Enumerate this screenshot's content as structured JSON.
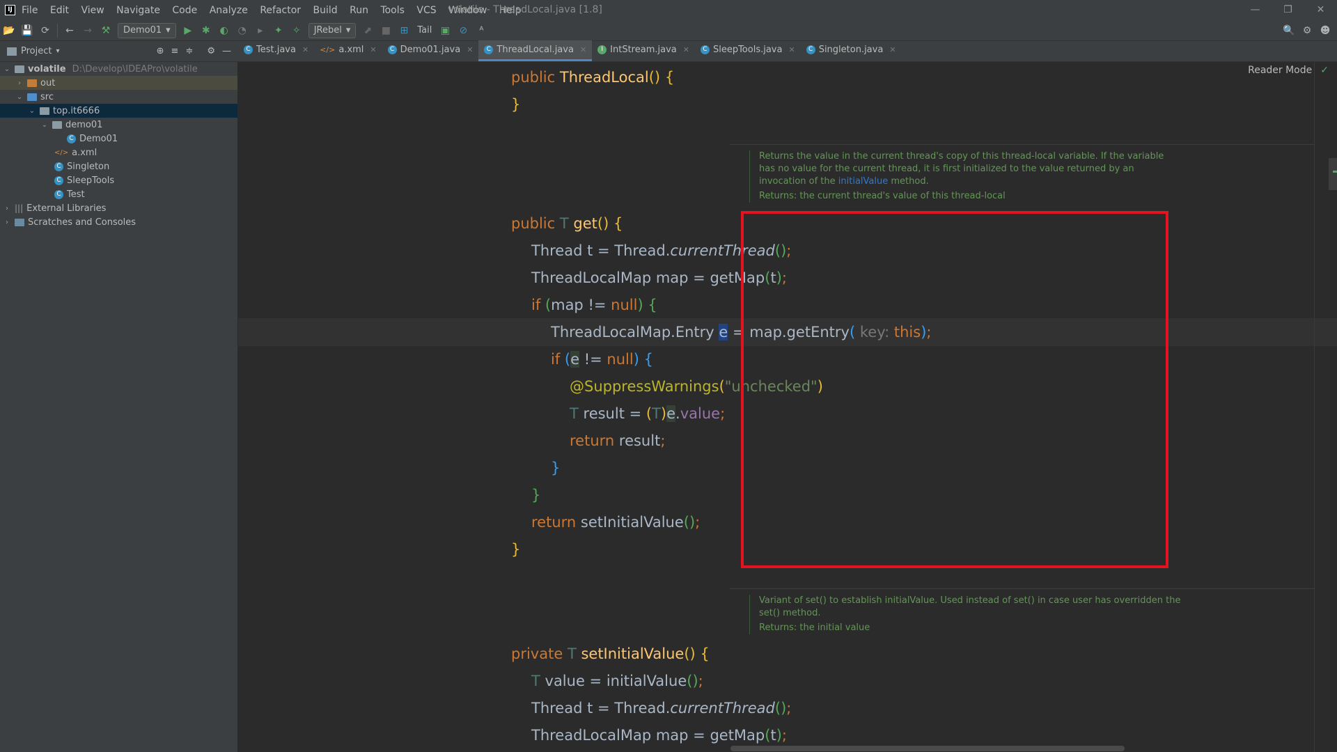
{
  "window": {
    "title": "volatile - ThreadLocal.java [1.8]",
    "app_icon": "IJ",
    "controls": [
      "—",
      "❐",
      "✕"
    ]
  },
  "menu": [
    "File",
    "Edit",
    "View",
    "Navigate",
    "Code",
    "Analyze",
    "Refactor",
    "Build",
    "Run",
    "Tools",
    "VCS",
    "Window",
    "Help"
  ],
  "toolbar": {
    "run_config": "Demo01",
    "jrebel": "JRebel",
    "tail": "Tail"
  },
  "project_panel": {
    "title": "Project",
    "tree": [
      {
        "label": "volatile",
        "path": "D:\\Develop\\IDEAPro\\volatile"
      },
      {
        "label": "out"
      },
      {
        "label": "src"
      },
      {
        "label": "top.it6666"
      },
      {
        "label": "demo01"
      },
      {
        "label": "Demo01"
      },
      {
        "label": "a.xml"
      },
      {
        "label": "Singleton"
      },
      {
        "label": "SleepTools"
      },
      {
        "label": "Test"
      },
      {
        "label": "External Libraries"
      },
      {
        "label": "Scratches and Consoles"
      }
    ]
  },
  "tabs": [
    "Test.java",
    "a.xml",
    "Demo01.java",
    "ThreadLocal.java",
    "IntStream.java",
    "SleepTools.java",
    "Singleton.java"
  ],
  "active_tab": "ThreadLocal.java",
  "editor": {
    "reader_mode": "Reader Mode",
    "doc1": {
      "text": "Returns the value in the current thread's copy of this thread-local variable. If the variable has no value for the current thread, it is first initialized to the value returned by an invocation of the",
      "link": "initialValue",
      "tail": " method.",
      "returns": "Returns: the current thread's value of this thread-local"
    },
    "doc2": {
      "text": "Variant of set() to establish initialValue. Used instead of set() in case user has overridden the set() method.",
      "returns": "Returns: the initial value"
    },
    "param_hint": "key:"
  }
}
